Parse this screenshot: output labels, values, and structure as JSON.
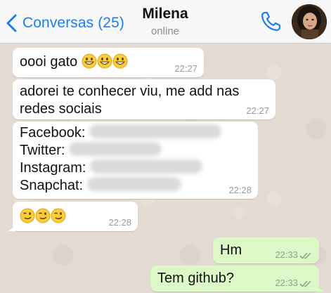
{
  "header": {
    "back_label": "Conversas (25)",
    "contact_name": "Milena",
    "status": "online"
  },
  "messages": [
    {
      "text": "oooi gato",
      "emojis": [
        "grinning-face",
        "grinning-face",
        "grinning-face"
      ],
      "time": "22:27",
      "direction": "incoming"
    },
    {
      "text": "adorei te conhecer viu, me add nas redes sociais",
      "line1": "adorei te conhecer viu, me add nas",
      "line2": "redes sociais",
      "time": "22:27",
      "direction": "incoming"
    },
    {
      "lines": [
        {
          "label": "Facebook:",
          "value_hidden": true
        },
        {
          "label": "Twitter:",
          "value_hidden": true
        },
        {
          "label": "Instagram:",
          "value_hidden": true
        },
        {
          "label": "Snapchat:",
          "value_hidden": true
        }
      ],
      "time": "22:28",
      "direction": "incoming"
    },
    {
      "emojis": [
        "winking-face",
        "winking-face",
        "winking-face"
      ],
      "time": "22:28",
      "direction": "incoming"
    },
    {
      "text": "Hm",
      "time": "22:33",
      "direction": "outgoing",
      "read": true
    },
    {
      "text": "Tem github?",
      "time": "22:33",
      "direction": "outgoing",
      "read": true
    }
  ],
  "colors": {
    "accent": "#1a7ef0",
    "incoming_bubble": "#ffffff",
    "outgoing_bubble": "#dcf8c6",
    "read_ticks": "#8fa383"
  }
}
